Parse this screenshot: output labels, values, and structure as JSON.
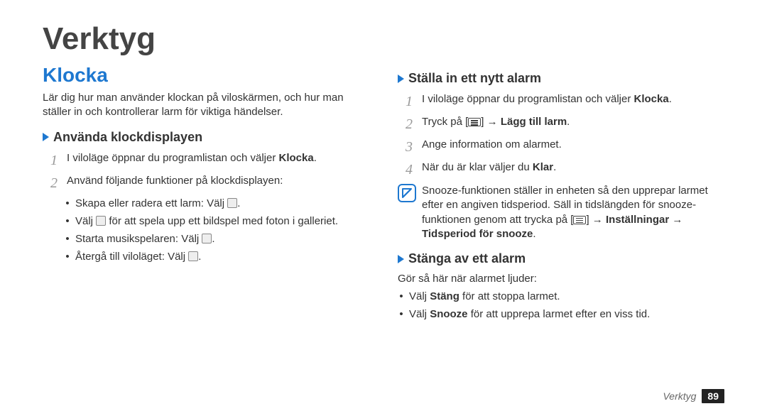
{
  "title": "Verktyg",
  "footer": {
    "section": "Verktyg",
    "page": "89"
  },
  "left": {
    "h2": "Klocka",
    "intro": "Lär dig hur man använder klockan på viloskärmen, och hur man ställer in och kontrollerar larm för viktiga händelser.",
    "h3": "Använda klockdisplayen",
    "step1_a": "I viloläge öppnar du programlistan och väljer ",
    "step1_b": "Klocka",
    "step1_c": ".",
    "step2": "Använd följande funktioner på klockdisplayen:",
    "b1_a": "Skapa eller radera ett larm: Välj ",
    "b1_b": ".",
    "b2_a": "Välj ",
    "b2_b": " för att spela upp ett bildspel med foton i galleriet.",
    "b3_a": "Starta musikspelaren: Välj ",
    "b3_b": ".",
    "b4_a": "Återgå till viloläget: Välj ",
    "b4_b": "."
  },
  "right": {
    "h3a": "Ställa in ett nytt alarm",
    "s1_a": "I viloläge öppnar du programlistan och väljer ",
    "s1_b": "Klocka",
    "s1_c": ".",
    "s2_a": "Tryck på [",
    "s2_b": "] → ",
    "s2_c": "Lägg till larm",
    "s2_d": ".",
    "s3": "Ange information om alarmet.",
    "s4_a": "När du är klar väljer du ",
    "s4_b": "Klar",
    "s4_c": ".",
    "note_a": "Snooze-funktionen ställer in enheten så den upprepar larmet efter en angiven tidsperiod. Säll in tidslängden för snooze-funktionen genom att trycka på [",
    "note_b": "] → ",
    "note_c": "Inställningar",
    "note_d": " → ",
    "note_e": "Tidsperiod för snooze",
    "note_f": ".",
    "h3b": "Stänga av ett alarm",
    "pb": "Gör så här när alarmet ljuder:",
    "bb1_a": "Välj ",
    "bb1_b": "Stäng",
    "bb1_c": " för att stoppa larmet.",
    "bb2_a": "Välj ",
    "bb2_b": "Snooze",
    "bb2_c": " för att upprepa larmet efter en viss tid."
  }
}
